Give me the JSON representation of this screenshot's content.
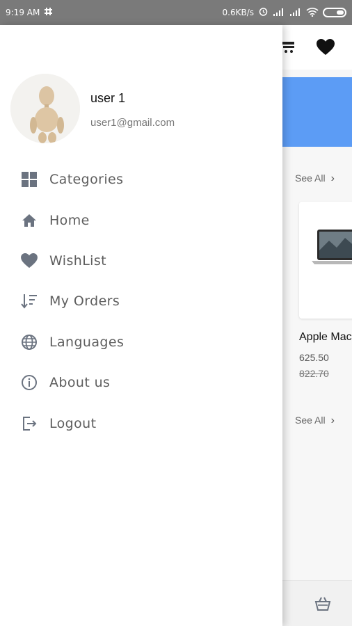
{
  "status_bar": {
    "time": "9:19 AM",
    "network_speed": "0.6KB/s"
  },
  "drawer": {
    "user": {
      "name": "user 1",
      "email": "user1@gmail.com"
    },
    "menu": [
      {
        "label": "Categories",
        "icon": "grid-icon"
      },
      {
        "label": "Home",
        "icon": "home-icon"
      },
      {
        "label": "WishList",
        "icon": "heart-icon"
      },
      {
        "label": "My Orders",
        "icon": "sort-icon"
      },
      {
        "label": "Languages",
        "icon": "globe-icon"
      },
      {
        "label": "About us",
        "icon": "info-icon"
      },
      {
        "label": "Logout",
        "icon": "logout-icon"
      }
    ]
  },
  "background_app": {
    "see_all_1": "See All",
    "see_all_2": "See All",
    "product": {
      "name": "Apple Mac",
      "price": "625.50",
      "old_price": "822.70"
    },
    "colors": {
      "banner": "#5c9cf5",
      "icon_gray": "#6b7380"
    }
  }
}
